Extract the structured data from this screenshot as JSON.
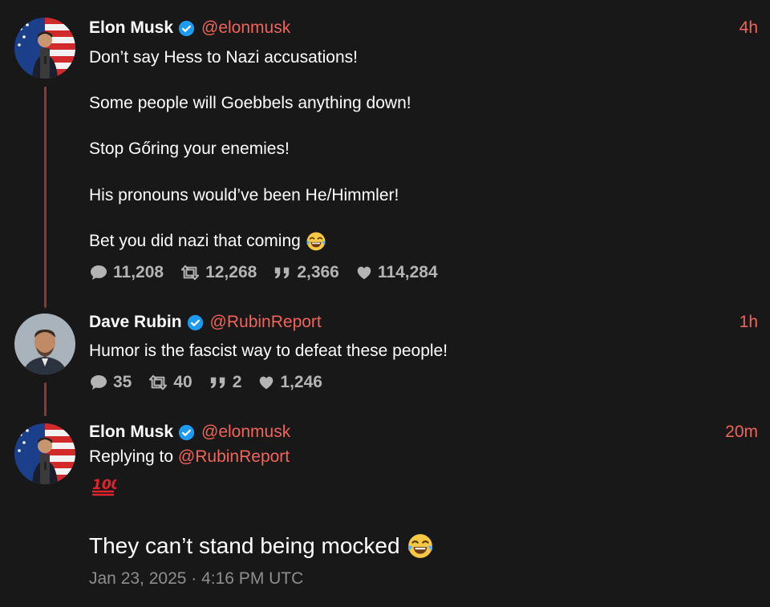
{
  "tweets": [
    {
      "name": "Elon Musk",
      "handle": "@elonmusk",
      "time": "4h",
      "lines": [
        "Don’t say Hess to Nazi accusations!",
        "Some people will Goebbels anything down!",
        "Stop Gőring your enemies!",
        "His pronouns would’ve been He/Himmler!",
        "Bet you did nazi that coming"
      ],
      "stats": {
        "replies": "11,208",
        "retweets": "12,268",
        "quotes": "2,366",
        "likes": "114,284"
      }
    },
    {
      "name": "Dave Rubin",
      "handle": "@RubinReport",
      "time": "1h",
      "lines": [
        "Humor is the fascist way to defeat these people!"
      ],
      "stats": {
        "replies": "35",
        "retweets": "40",
        "quotes": "2",
        "likes": "1,246"
      }
    },
    {
      "name": "Elon Musk",
      "handle": "@elonmusk",
      "time": "20m",
      "replying_prefix": "Replying to",
      "replying_handle": "@RubinReport",
      "big_text": "They can’t stand being mocked",
      "date": "Jan 23, 2025 · 4:16 PM UTC"
    }
  ],
  "icons": {
    "reply": "speech-bubble-icon",
    "retweet": "retweet-icon",
    "quote": "quote-icon",
    "like": "heart-icon",
    "verified": "verified-badge-icon",
    "laugh": "tears-of-joy-emoji",
    "hundred": "hundred-points-emoji"
  },
  "colors": {
    "background": "#181818",
    "accent": "#f0645a",
    "verified": "#1d9bf0",
    "stat_text": "#b4b4b4",
    "thread_line": "#8a3a35",
    "date": "#8e8e8e"
  }
}
